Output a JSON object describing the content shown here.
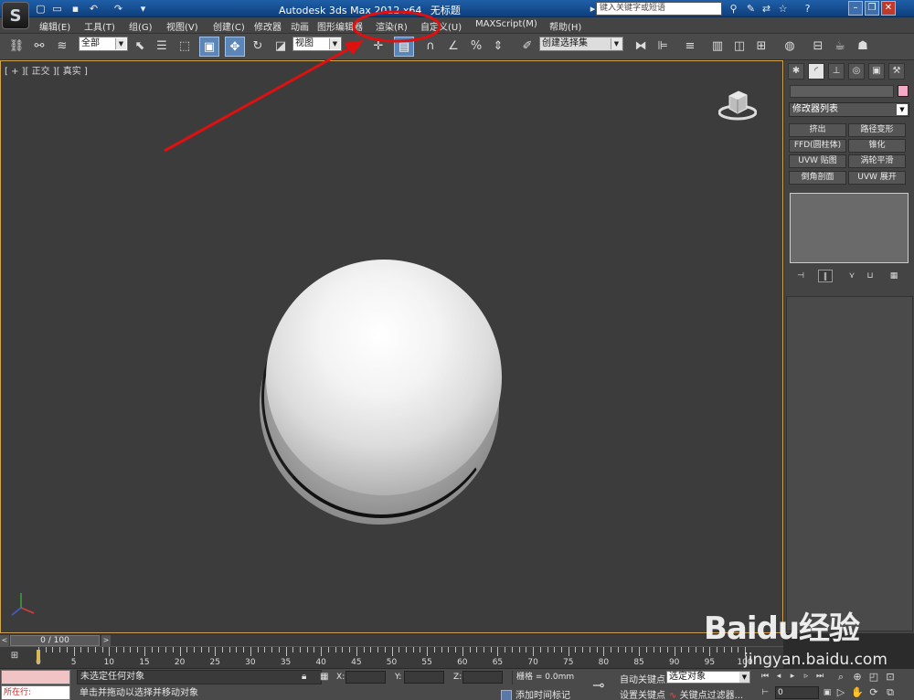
{
  "titlebar": {
    "app_title": "Autodesk 3ds Max  2012 x64",
    "doc_name": "无标题",
    "search_placeholder": "键入关键字或短语"
  },
  "menubar": {
    "items": [
      "编辑(E)",
      "工具(T)",
      "组(G)",
      "视图(V)",
      "创建(C)",
      "修改器",
      "动画",
      "图形编辑器",
      "渲染(R)",
      "自定义(U)",
      "MAXScript(M)",
      "帮助(H)"
    ]
  },
  "toolbar": {
    "selection_filter": "全部",
    "ref_coord": "视图",
    "named_selection": "创建选择集"
  },
  "viewport": {
    "label": "[ + ][ 正交 ][ 真实 ]"
  },
  "command_panel": {
    "modifier_list": "修改器列表",
    "modifier_buttons": [
      "挤出",
      "路径变形",
      "FFD(圆柱体)",
      "锥化",
      "UVW 贴图",
      "涡轮平滑",
      "倒角剖面",
      "UVW 展开"
    ],
    "object_color": "#f4a9c7"
  },
  "timeline": {
    "frame_counter": "0 / 100",
    "ticks": [
      "0",
      "5",
      "10",
      "15",
      "20",
      "25",
      "30",
      "35",
      "40",
      "45",
      "50",
      "55",
      "60",
      "65",
      "70",
      "75",
      "80",
      "85",
      "90",
      "95",
      "100"
    ]
  },
  "statusbar": {
    "listener_text": "所在行:",
    "status_top": "未选定任何对象",
    "status_bottom": "单击并拖动以选择并移动对象",
    "x_label": "X:",
    "y_label": "Y:",
    "z_label": "Z:",
    "grid": "栅格 = 0.0mm",
    "add_time_tag": "添加时间标记",
    "auto_key": "自动关键点",
    "set_key": "设置关键点",
    "selected_set": "选定对象",
    "key_filters": "关键点过滤器...",
    "current_frame": "0"
  },
  "annotation": {
    "color": "#e01010"
  },
  "watermark": {
    "brand": "Baidu经验",
    "url": "jingyan.baidu.com"
  }
}
